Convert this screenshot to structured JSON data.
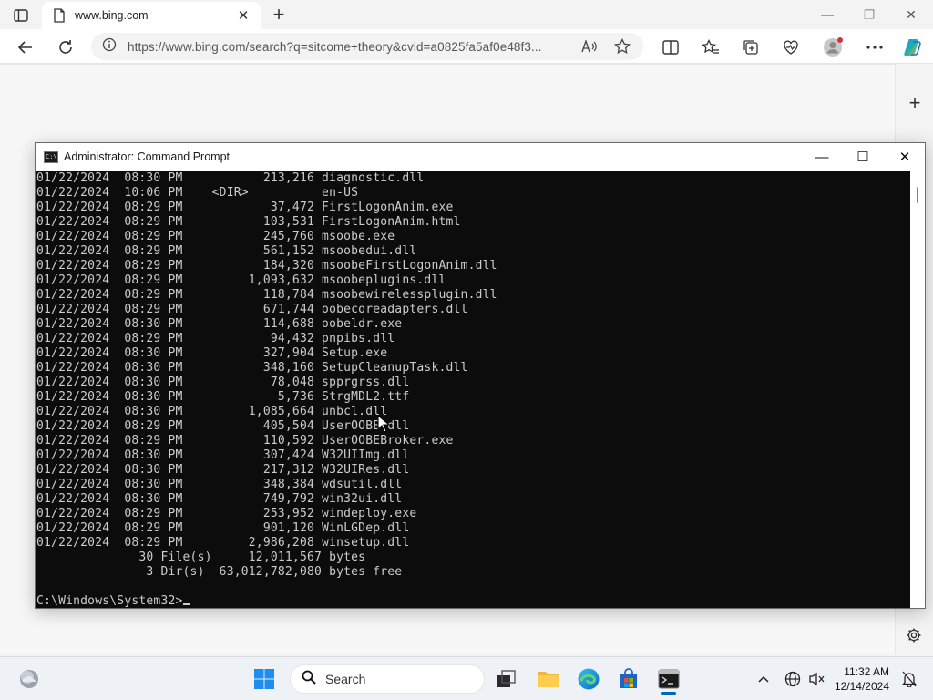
{
  "browser": {
    "tab": {
      "title": "www.bing.com",
      "close": "✕"
    },
    "newtab": "+",
    "window_controls": {
      "minimize": "—",
      "restore": "❐",
      "close": "✕"
    },
    "address_url": "https://www.bing.com/search?q=sitcome+theory&cvid=a0825fa5af0e48f3...",
    "read_aloud": "A)",
    "sidebar_add": "+"
  },
  "cmd": {
    "title": "Administrator: Command Prompt",
    "controls": {
      "minimize": "—",
      "maximize": "☐",
      "close": "✕"
    },
    "lines": [
      "01/22/2024  08:30 PM           213,216 diagnostic.dll",
      "01/22/2024  10:06 PM    <DIR>          en-US",
      "01/22/2024  08:29 PM            37,472 FirstLogonAnim.exe",
      "01/22/2024  08:29 PM           103,531 FirstLogonAnim.html",
      "01/22/2024  08:29 PM           245,760 msoobe.exe",
      "01/22/2024  08:29 PM           561,152 msoobedui.dll",
      "01/22/2024  08:29 PM           184,320 msoobeFirstLogonAnim.dll",
      "01/22/2024  08:29 PM         1,093,632 msoobeplugins.dll",
      "01/22/2024  08:29 PM           118,784 msoobewirelessplugin.dll",
      "01/22/2024  08:29 PM           671,744 oobecoreadapters.dll",
      "01/22/2024  08:30 PM           114,688 oobeldr.exe",
      "01/22/2024  08:29 PM            94,432 pnpibs.dll",
      "01/22/2024  08:30 PM           327,904 Setup.exe",
      "01/22/2024  08:30 PM           348,160 SetupCleanupTask.dll",
      "01/22/2024  08:30 PM            78,048 spprgrss.dll",
      "01/22/2024  08:30 PM             5,736 StrgMDL2.ttf",
      "01/22/2024  08:30 PM         1,085,664 unbcl.dll",
      "01/22/2024  08:29 PM           405,504 UserOOBE.dll",
      "01/22/2024  08:29 PM           110,592 UserOOBEBroker.exe",
      "01/22/2024  08:30 PM           307,424 W32UIImg.dll",
      "01/22/2024  08:30 PM           217,312 W32UIRes.dll",
      "01/22/2024  08:30 PM           348,384 wdsutil.dll",
      "01/22/2024  08:30 PM           749,792 win32ui.dll",
      "01/22/2024  08:29 PM           253,952 windeploy.exe",
      "01/22/2024  08:29 PM           901,120 WinLGDep.dll",
      "01/22/2024  08:29 PM         2,986,208 winsetup.dll",
      "              30 File(s)     12,011,567 bytes",
      "               3 Dir(s)  63,012,782,080 bytes free",
      "",
      "C:\\Windows\\System32>"
    ]
  },
  "taskbar": {
    "search_label": "Search",
    "clock_time": "11:32 AM",
    "clock_date": "12/14/2024"
  },
  "colors": {
    "console_bg": "#0c0c0c",
    "console_text": "#cccccc",
    "accent": "#0067c0"
  }
}
